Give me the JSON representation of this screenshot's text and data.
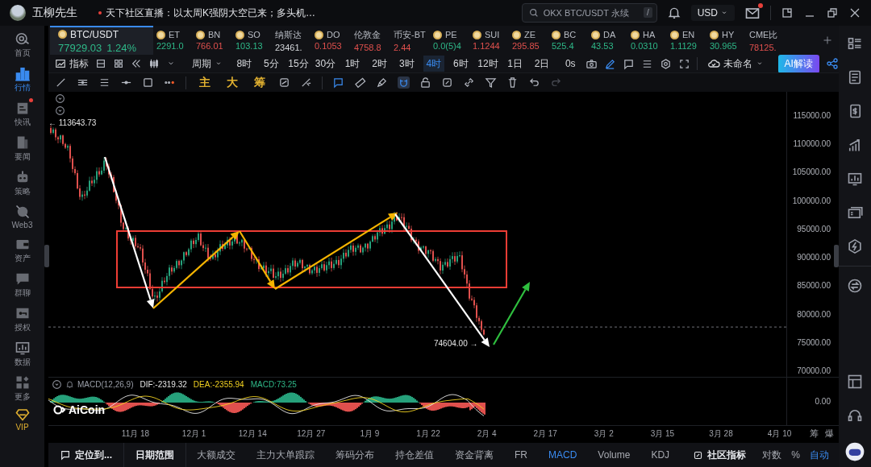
{
  "header": {
    "user": "五柳先生",
    "news": "天下社区直播：以太周K强阴大空已来；多头机…",
    "search": {
      "placeholder": "OKX BTC/USDT 永续",
      "shortcut": "/"
    },
    "currency": "USD",
    "mail_unread": true
  },
  "sidebar": {
    "items": [
      {
        "label": "首页",
        "selected": false,
        "unread": false
      },
      {
        "label": "行情",
        "selected": true,
        "unread": false
      },
      {
        "label": "快讯",
        "selected": false,
        "unread": true
      },
      {
        "label": "要闻",
        "selected": false,
        "unread": false
      },
      {
        "label": "策略",
        "selected": false,
        "unread": false
      },
      {
        "label": "Web3",
        "selected": false,
        "unread": false
      },
      {
        "label": "资产",
        "selected": false,
        "unread": false
      },
      {
        "label": "群聊",
        "selected": false,
        "unread": false
      },
      {
        "label": "授权",
        "selected": false,
        "unread": false
      },
      {
        "label": "数据",
        "selected": false,
        "unread": false
      },
      {
        "label": "更多",
        "selected": false,
        "unread": false
      },
      {
        "label": "VIP",
        "selected": false,
        "unread": false
      }
    ]
  },
  "tickers": [
    {
      "symbol": "BTC/USDT",
      "price": "77929.03",
      "change": "1.24%",
      "kind": "up",
      "has_icon": true,
      "selected": true
    },
    {
      "symbol": "ET",
      "price": "2291.0",
      "kind": "up",
      "has_icon": true,
      "selected": false
    },
    {
      "symbol": "BN",
      "price": "766.01",
      "kind": "down",
      "has_icon": true,
      "selected": false
    },
    {
      "symbol": "SO",
      "price": "103.13",
      "kind": "up",
      "has_icon": true,
      "selected": false
    },
    {
      "symbol": "纳斯达",
      "price": "23461.",
      "kind": "flat",
      "has_icon": false,
      "selected": false
    },
    {
      "symbol": "DO",
      "price": "0.1053",
      "kind": "down",
      "has_icon": true,
      "selected": false
    },
    {
      "symbol": "伦敦金",
      "price": "4758.8",
      "kind": "down",
      "has_icon": false,
      "selected": false
    },
    {
      "symbol": "币安-BT",
      "price": "2.44",
      "kind": "down",
      "has_icon": false,
      "selected": false
    },
    {
      "symbol": "PE",
      "price": "0.0(5)4",
      "kind": "up",
      "has_icon": true,
      "selected": false
    },
    {
      "symbol": "SUI",
      "price": "1.1244",
      "kind": "down",
      "has_icon": true,
      "selected": false
    },
    {
      "symbol": "ZE",
      "price": "295.85",
      "kind": "down",
      "has_icon": true,
      "selected": false
    },
    {
      "symbol": "BC",
      "price": "525.4",
      "kind": "up",
      "has_icon": true,
      "selected": false
    },
    {
      "symbol": "DA",
      "price": "43.53",
      "kind": "up",
      "has_icon": true,
      "selected": false
    },
    {
      "symbol": "HA",
      "price": "0.0310",
      "kind": "up",
      "has_icon": true,
      "selected": false
    },
    {
      "symbol": "EN",
      "price": "1.1129",
      "kind": "up",
      "has_icon": true,
      "selected": false
    },
    {
      "symbol": "HY",
      "price": "30.965",
      "kind": "up",
      "has_icon": true,
      "selected": false
    },
    {
      "symbol": "CME比",
      "price": "78125.",
      "kind": "down",
      "has_icon": false,
      "selected": false
    }
  ],
  "toolbar": {
    "indicator_label": "指标",
    "period_label": "周期",
    "intervals": [
      {
        "label": "8时",
        "selected": false
      },
      {
        "label": "5分",
        "selected": false
      },
      {
        "label": "15分",
        "selected": false
      },
      {
        "label": "30分",
        "selected": false
      },
      {
        "label": "1时",
        "selected": false
      },
      {
        "label": "2时",
        "selected": false
      },
      {
        "label": "3时",
        "selected": false
      },
      {
        "label": "4时",
        "selected": true
      },
      {
        "label": "6时",
        "selected": false
      },
      {
        "label": "12时",
        "selected": false
      },
      {
        "label": "1日",
        "selected": false
      },
      {
        "label": "2日",
        "selected": false
      }
    ],
    "countdown": "0s",
    "layout_name": "未命名",
    "ai_button": "AI解读"
  },
  "drawing_tools": {
    "quick": [
      "主",
      "大",
      "筹"
    ]
  },
  "chart": {
    "price_ticks": [
      "115000.00",
      "110000.00",
      "105000.00",
      "100000.00",
      "95000.00",
      "90000.00",
      "85000.00",
      "80000.00",
      "75000.00",
      "70000.00"
    ],
    "high_label": "← 113643.73",
    "low_label": "74604.00 →",
    "date_ticks": [
      "11月 18",
      "12月 1",
      "12月 14",
      "12月 27",
      "1月 9",
      "1月 22",
      "2月 4",
      "2月 17",
      "3月 2",
      "3月 15",
      "3月 28",
      "4月 10"
    ],
    "side_labels": [
      "筹",
      "爆"
    ]
  },
  "macd": {
    "title": "MACD(12,26,9)",
    "dif": "DIF:-2319.32",
    "dea": "DEA:-2355.94",
    "value": "MACD:73.25",
    "zero_tick": "0.00",
    "logo": "AiCoin"
  },
  "bottom_bar": {
    "locate": "定位到...",
    "date_range": "日期范围",
    "tabs": [
      {
        "label": "大额成交",
        "selected": false
      },
      {
        "label": "主力大单跟踪",
        "selected": false
      },
      {
        "label": "筹码分布",
        "selected": false
      },
      {
        "label": "持仓差值",
        "selected": false
      },
      {
        "label": "资金背离",
        "selected": false
      },
      {
        "label": "FR",
        "selected": false
      },
      {
        "label": "MACD",
        "selected": true
      },
      {
        "label": "Volume",
        "selected": false
      },
      {
        "label": "KDJ",
        "selected": false
      }
    ],
    "community": "社区指标",
    "options": [
      {
        "label": "对数",
        "selected": false
      },
      {
        "label": "%",
        "selected": false
      },
      {
        "label": "自动",
        "selected": true
      }
    ]
  }
}
